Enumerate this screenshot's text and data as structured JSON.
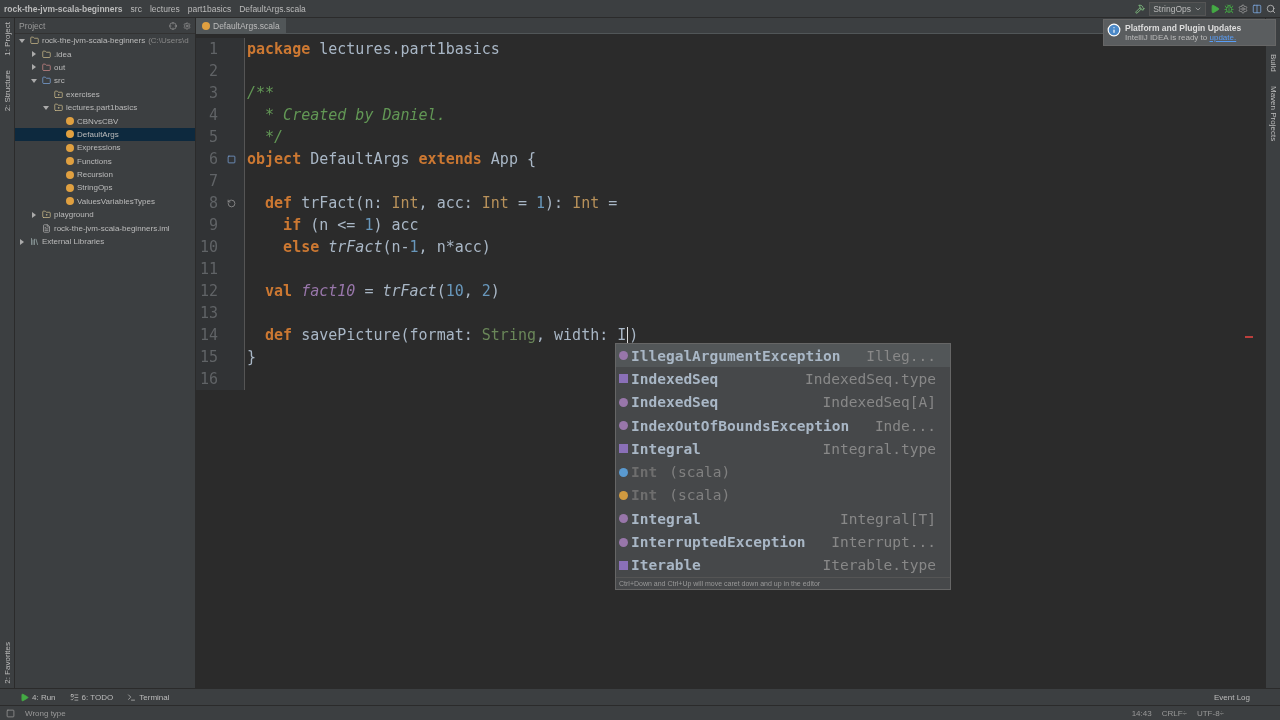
{
  "breadcrumbs": [
    "rock-the-jvm-scala-beginners",
    "src",
    "lectures",
    "part1basics",
    "DefaultArgs.scala"
  ],
  "run_config": "StringOps",
  "notification": {
    "title": "Platform and Plugin Updates",
    "text": "IntelliJ IDEA is ready to ",
    "link": "update."
  },
  "left_stripe": {
    "top": [
      "1: Project",
      "2: Structure"
    ],
    "bottom": [
      "2: Favorites"
    ]
  },
  "right_stripe": [
    "Build",
    "Maven Projects"
  ],
  "project_panel": {
    "title": "Project",
    "tree": [
      {
        "label": "rock-the-jvm-scala-beginners",
        "detail": "(C:\\Users\\d",
        "kind": "module",
        "expanded": true,
        "selected": false,
        "children": [
          {
            "label": ".idea",
            "kind": "folder",
            "expanded": false,
            "selected": false
          },
          {
            "label": "out",
            "kind": "excluded",
            "expanded": false,
            "selected": false
          },
          {
            "label": "src",
            "kind": "source",
            "expanded": true,
            "selected": false,
            "children": [
              {
                "label": "exercises",
                "kind": "package",
                "selected": false
              },
              {
                "label": "lectures.part1basics",
                "kind": "package",
                "expanded": true,
                "selected": false,
                "children": [
                  {
                    "label": "CBNvsCBV",
                    "kind": "object",
                    "selected": false
                  },
                  {
                    "label": "DefaultArgs",
                    "kind": "object",
                    "selected": true
                  },
                  {
                    "label": "Expressions",
                    "kind": "object",
                    "selected": false
                  },
                  {
                    "label": "Functions",
                    "kind": "object",
                    "selected": false
                  },
                  {
                    "label": "Recursion",
                    "kind": "object",
                    "selected": false
                  },
                  {
                    "label": "StringOps",
                    "kind": "object",
                    "selected": false
                  },
                  {
                    "label": "ValuesVariablesTypes",
                    "kind": "object",
                    "selected": false
                  }
                ]
              }
            ]
          },
          {
            "label": "playground",
            "kind": "package",
            "expanded": false,
            "selected": false
          },
          {
            "label": "rock-the-jvm-scala-beginners.iml",
            "kind": "file",
            "selected": false
          }
        ]
      },
      {
        "label": "External Libraries",
        "kind": "library",
        "expanded": false,
        "selected": false
      }
    ]
  },
  "editor_tab": {
    "label": "DefaultArgs.scala",
    "selected": true
  },
  "code_lines": [
    {
      "number": "1",
      "tokens": [
        {
          "kind": "kw",
          "text": "package"
        },
        {
          "kind": "plain",
          "text": " lectures.part1basics"
        }
      ]
    },
    {
      "number": "2"
    },
    {
      "number": "3",
      "tokens": [
        {
          "kind": "comment",
          "text": "/**"
        }
      ]
    },
    {
      "number": "4",
      "tokens": [
        {
          "kind": "comment",
          "text": "  * Created by Daniel."
        }
      ]
    },
    {
      "number": "5",
      "tokens": [
        {
          "kind": "comment",
          "text": "  */"
        }
      ]
    },
    {
      "number": "6",
      "kind": "object",
      "tokens": [
        {
          "kind": "kw",
          "text": "object"
        },
        {
          "kind": "plain",
          "text": " DefaultArgs "
        },
        {
          "kind": "kw",
          "text": "extends"
        },
        {
          "kind": "plain",
          "text": " App {"
        }
      ]
    },
    {
      "number": "7"
    },
    {
      "number": "8",
      "kind": "recursive",
      "tokens": [
        {
          "kind": "kw",
          "text": "  def"
        },
        {
          "kind": "plain",
          "text": " trFact(n: "
        },
        {
          "kind": "type",
          "text": "Int"
        },
        {
          "kind": "plain",
          "text": ", acc: "
        },
        {
          "kind": "type",
          "text": "Int"
        },
        {
          "kind": "plain",
          "text": " = "
        },
        {
          "kind": "num",
          "text": "1"
        },
        {
          "kind": "plain",
          "text": "): "
        },
        {
          "kind": "type",
          "text": "Int"
        },
        {
          "kind": "plain",
          "text": " ="
        }
      ]
    },
    {
      "number": "9",
      "tokens": [
        {
          "kind": "kw",
          "text": "    if"
        },
        {
          "kind": "plain",
          "text": " (n <= "
        },
        {
          "kind": "num",
          "text": "1"
        },
        {
          "kind": "plain",
          "text": ") acc"
        }
      ]
    },
    {
      "number": "10",
      "tokens": [
        {
          "kind": "kw",
          "text": "    else"
        },
        {
          "kind": "call",
          "text": " trFact"
        },
        {
          "kind": "plain",
          "text": "(n-"
        },
        {
          "kind": "num",
          "text": "1"
        },
        {
          "kind": "plain",
          "text": ", n*acc)"
        }
      ]
    },
    {
      "number": "11"
    },
    {
      "number": "12",
      "tokens": [
        {
          "kind": "kw",
          "text": "  val"
        },
        {
          "kind": "field",
          "text": " fact10"
        },
        {
          "kind": "plain",
          "text": " = "
        },
        {
          "kind": "call",
          "text": "trFact"
        },
        {
          "kind": "plain",
          "text": "("
        },
        {
          "kind": "num",
          "text": "10"
        },
        {
          "kind": "plain",
          "text": ", "
        },
        {
          "kind": "num",
          "text": "2"
        },
        {
          "kind": "plain",
          "text": ")"
        }
      ]
    },
    {
      "number": "13"
    },
    {
      "number": "14",
      "tokens": [
        {
          "kind": "kw",
          "text": "  def"
        },
        {
          "kind": "plain",
          "text": " savePicture(format: "
        },
        {
          "kind": "string_type",
          "text": "String"
        },
        {
          "kind": "plain",
          "text": ", width: I"
        },
        {
          "kind": "caret"
        },
        {
          "kind": "plain",
          "text": ")"
        }
      ]
    },
    {
      "number": "15",
      "tokens": [
        {
          "kind": "plain",
          "text": "}"
        }
      ]
    },
    {
      "number": "16"
    }
  ],
  "completion": {
    "items": [
      {
        "kind": "class",
        "name": "IllegalArgumentException",
        "detail": "Illeg...",
        "selected": true,
        "dimmed": false
      },
      {
        "kind": "type",
        "name": "IndexedSeq",
        "detail": "IndexedSeq.type",
        "selected": false,
        "dimmed": false
      },
      {
        "kind": "class",
        "name": "IndexedSeq",
        "detail": "IndexedSeq[A]",
        "selected": false,
        "dimmed": false
      },
      {
        "kind": "class",
        "name": "IndexOutOfBoundsException",
        "detail": "Inde...",
        "selected": false,
        "dimmed": false
      },
      {
        "kind": "type",
        "name": "Integral",
        "detail": "Integral.type",
        "selected": false,
        "dimmed": false
      },
      {
        "kind": "scala_class",
        "name": "Int",
        "detail": "(scala)",
        "selected": false,
        "dimmed": true
      },
      {
        "kind": "object",
        "name": "Int",
        "detail": "(scala)",
        "selected": false,
        "dimmed": true
      },
      {
        "kind": "class",
        "name": "Integral",
        "detail": "Integral[T]",
        "selected": false,
        "dimmed": false
      },
      {
        "kind": "class",
        "name": "InterruptedException",
        "detail": "Interrupt...",
        "selected": false,
        "dimmed": false
      },
      {
        "kind": "type",
        "name": "Iterable",
        "detail": "Iterable.type",
        "selected": false,
        "dimmed": false
      }
    ],
    "hint": "Ctrl+Down and Ctrl+Up will move caret down and up in the editor"
  },
  "tool_windows": [
    {
      "label": "4: Run",
      "kind": "run"
    },
    {
      "label": "6: TODO",
      "kind": "todo"
    },
    {
      "label": "Terminal",
      "kind": "terminal"
    }
  ],
  "event_log": "Event Log",
  "status_bar": {
    "message": "Wrong type",
    "position": "14:43",
    "line_separator": "CRLF÷",
    "encoding": "UTF-8÷"
  }
}
